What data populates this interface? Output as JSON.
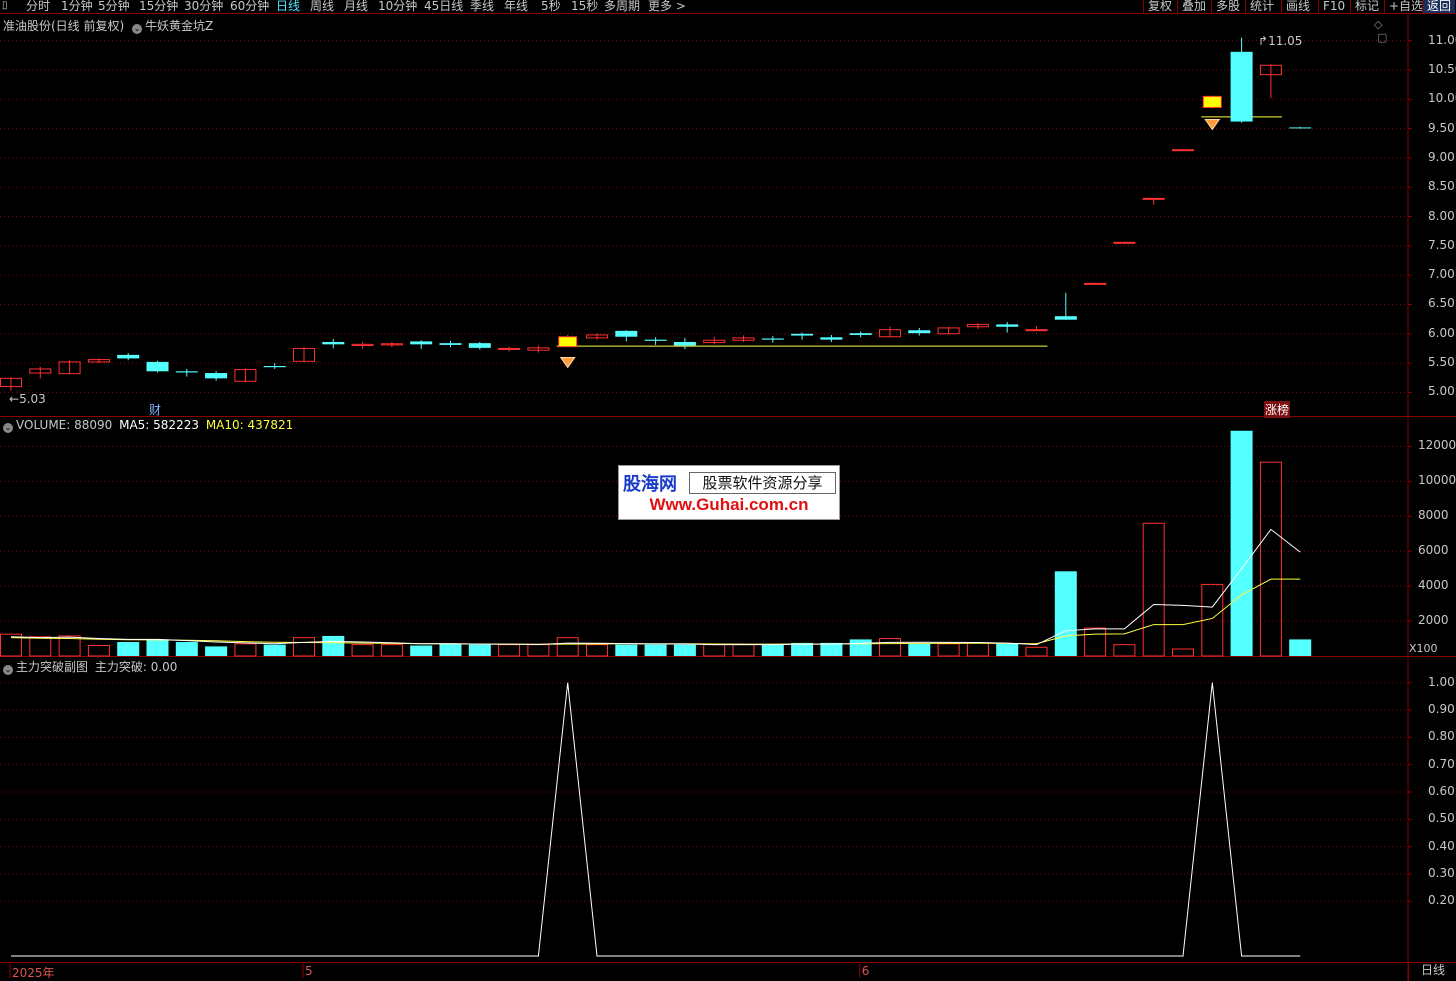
{
  "toolbar": {
    "periods": [
      "分时",
      "1分钟",
      "5分钟",
      "15分钟",
      "30分钟",
      "60分钟",
      "日线",
      "周线",
      "月线",
      "10分钟",
      "45日线",
      "季线",
      "年线",
      "5秒",
      "15秒",
      "多周期",
      "更多 >"
    ],
    "active_period": "日线",
    "right_items": [
      "复权",
      "叠加",
      "多股",
      "统计",
      "画线",
      "F10",
      "标记",
      "+自选",
      "返回"
    ]
  },
  "main_panel": {
    "title": "准油股份(日线 前复权)",
    "indicator_name": "牛妖黄金坑Z",
    "high_marker": "11.05",
    "low_marker": "5.03",
    "cai_badge": "财",
    "zhangbang_badge": "涨榜",
    "y_ticks": [
      "11.00",
      "10.50",
      "10.00",
      "9.50",
      "9.00",
      "8.50",
      "8.00",
      "7.50",
      "7.00",
      "6.50",
      "6.00",
      "5.50",
      "5.00"
    ]
  },
  "volume_panel": {
    "label_volume": "VOLUME: 88090",
    "label_ma5": "MA5: 582223",
    "label_ma10": "MA10: 437821",
    "y_ticks": [
      "12000",
      "10000",
      "8000",
      "6000",
      "4000",
      "2000"
    ],
    "unit": "X100"
  },
  "sub_panel": {
    "title": "主力突破副图",
    "value_label": "主力突破: 0.00",
    "y_ticks": [
      "1.00",
      "0.90",
      "0.80",
      "0.70",
      "0.60",
      "0.50",
      "0.40",
      "0.30",
      "0.20"
    ]
  },
  "x_axis": {
    "labels": [
      "2025年",
      "5",
      "6"
    ]
  },
  "bottom_tab": "日线",
  "watermark": {
    "brand": "股海网",
    "tagline": "股票软件资源分享",
    "url": "Www.Guhai.com.cn"
  },
  "colors": {
    "up": "#ff3030",
    "down": "#54ffff",
    "ma5": "#ffffff",
    "ma10": "#ffff40",
    "grid": "#8a0000",
    "signal": "#ffff00"
  },
  "chart_data": [
    {
      "type": "candlestick",
      "title": "准油股份(日线 前复权)",
      "ylim": [
        4.7,
        11.25
      ],
      "candles": [
        {
          "o": 5.1,
          "c": 5.24,
          "h": 5.26,
          "l": 5.03
        },
        {
          "o": 5.33,
          "c": 5.4,
          "h": 5.44,
          "l": 5.24
        },
        {
          "o": 5.32,
          "c": 5.52,
          "h": 5.55,
          "l": 5.31
        },
        {
          "o": 5.52,
          "c": 5.56,
          "h": 5.58,
          "l": 5.5
        },
        {
          "o": 5.64,
          "c": 5.58,
          "h": 5.67,
          "l": 5.55
        },
        {
          "o": 5.52,
          "c": 5.36,
          "h": 5.54,
          "l": 5.34
        },
        {
          "o": 5.36,
          "c": 5.34,
          "h": 5.4,
          "l": 5.27
        },
        {
          "o": 5.33,
          "c": 5.24,
          "h": 5.36,
          "l": 5.2
        },
        {
          "o": 5.19,
          "c": 5.39,
          "h": 5.41,
          "l": 5.17
        },
        {
          "o": 5.45,
          "c": 5.43,
          "h": 5.5,
          "l": 5.4
        },
        {
          "o": 5.53,
          "c": 5.75,
          "h": 5.77,
          "l": 5.52
        },
        {
          "o": 5.86,
          "c": 5.82,
          "h": 5.91,
          "l": 5.75
        },
        {
          "o": 5.8,
          "c": 5.82,
          "h": 5.86,
          "l": 5.75
        },
        {
          "o": 5.81,
          "c": 5.83,
          "h": 5.86,
          "l": 5.77
        },
        {
          "o": 5.87,
          "c": 5.82,
          "h": 5.89,
          "l": 5.74
        },
        {
          "o": 5.84,
          "c": 5.81,
          "h": 5.88,
          "l": 5.77
        },
        {
          "o": 5.84,
          "c": 5.76,
          "h": 5.86,
          "l": 5.73
        },
        {
          "o": 5.74,
          "c": 5.75,
          "h": 5.78,
          "l": 5.7
        },
        {
          "o": 5.72,
          "c": 5.76,
          "h": 5.8,
          "l": 5.68
        },
        {
          "o": 5.8,
          "c": 5.95,
          "h": 5.98,
          "l": 5.79
        },
        {
          "o": 5.93,
          "c": 5.98,
          "h": 6.01,
          "l": 5.9
        },
        {
          "o": 6.05,
          "c": 5.95,
          "h": 6.06,
          "l": 5.87
        },
        {
          "o": 5.9,
          "c": 5.88,
          "h": 5.94,
          "l": 5.81
        },
        {
          "o": 5.86,
          "c": 5.8,
          "h": 5.93,
          "l": 5.74
        },
        {
          "o": 5.85,
          "c": 5.89,
          "h": 5.95,
          "l": 5.82
        },
        {
          "o": 5.89,
          "c": 5.93,
          "h": 5.97,
          "l": 5.86
        },
        {
          "o": 5.92,
          "c": 5.9,
          "h": 5.96,
          "l": 5.85
        },
        {
          "o": 6.0,
          "c": 5.97,
          "h": 6.02,
          "l": 5.9
        },
        {
          "o": 5.94,
          "c": 5.9,
          "h": 5.98,
          "l": 5.86
        },
        {
          "o": 6.01,
          "c": 5.98,
          "h": 6.04,
          "l": 5.94
        },
        {
          "o": 5.95,
          "c": 6.07,
          "h": 6.12,
          "l": 5.94
        },
        {
          "o": 6.06,
          "c": 6.01,
          "h": 6.1,
          "l": 5.97
        },
        {
          "o": 6.0,
          "c": 6.1,
          "h": 6.12,
          "l": 5.99
        },
        {
          "o": 6.12,
          "c": 6.16,
          "h": 6.18,
          "l": 6.08
        },
        {
          "o": 6.16,
          "c": 6.12,
          "h": 6.2,
          "l": 6.02
        },
        {
          "o": 6.07,
          "c": 6.07,
          "h": 6.13,
          "l": 6.05
        },
        {
          "o": 6.3,
          "c": 6.24,
          "h": 6.7,
          "l": 6.24
        },
        {
          "o": 6.86,
          "c": 6.86,
          "h": 6.87,
          "l": 6.86
        },
        {
          "o": 7.56,
          "c": 7.56,
          "h": 7.57,
          "l": 7.56
        },
        {
          "o": 8.31,
          "c": 8.31,
          "h": 8.31,
          "l": 8.2
        },
        {
          "o": 9.14,
          "c": 9.14,
          "h": 9.15,
          "l": 9.14
        },
        {
          "o": 9.86,
          "c": 10.05,
          "h": 10.05,
          "l": 9.84
        },
        {
          "o": 10.81,
          "c": 9.62,
          "h": 11.05,
          "l": 9.6
        },
        {
          "o": 10.42,
          "c": 10.58,
          "h": 10.6,
          "l": 10.02
        },
        {
          "o": 9.52,
          "c": 9.51,
          "h": 9.53,
          "l": 9.5
        }
      ],
      "signal_candles": [
        19,
        41
      ],
      "support_lines": [
        {
          "from": 19,
          "to": 35,
          "value": 5.79
        },
        {
          "from": 41,
          "to": 43,
          "value": 9.7
        }
      ]
    },
    {
      "type": "bar",
      "title": "VOLUME",
      "ylim": [
        0,
        13000
      ],
      "values": [
        1250,
        1100,
        1150,
        600,
        800,
        950,
        800,
        550,
        700,
        650,
        1050,
        1150,
        650,
        650,
        600,
        700,
        650,
        650,
        650,
        1050,
        650,
        650,
        650,
        650,
        650,
        650,
        650,
        750,
        750,
        950,
        1000,
        700,
        700,
        750,
        700,
        500,
        4850,
        1600,
        650,
        7600,
        400,
        4100,
        12900,
        11100,
        950
      ],
      "ma5": [
        1100,
        1050,
        1080,
        1000,
        950,
        950,
        880,
        800,
        750,
        700,
        780,
        840,
        800,
        760,
        700,
        700,
        680,
        670,
        660,
        740,
        730,
        710,
        690,
        690,
        650,
        650,
        650,
        670,
        680,
        720,
        780,
        790,
        780,
        770,
        740,
        650,
        1450,
        1550,
        1550,
        2950,
        2900,
        2800,
        5000,
        7250,
        5950
      ],
      "ma10": [
        1050,
        1020,
        1000,
        960,
        930,
        920,
        900,
        870,
        820,
        790,
        770,
        760,
        740,
        720,
        700,
        700,
        690,
        680,
        670,
        680,
        690,
        700,
        700,
        700,
        690,
        680,
        680,
        690,
        690,
        700,
        710,
        720,
        720,
        730,
        720,
        700,
        1150,
        1250,
        1270,
        1800,
        1800,
        2150,
        3500,
        4400,
        4400
      ]
    },
    {
      "type": "line",
      "title": "主力突破副图",
      "ylim": [
        0,
        1.05
      ],
      "values": [
        0,
        0,
        0,
        0,
        0,
        0,
        0,
        0,
        0,
        0,
        0,
        0,
        0,
        0,
        0,
        0,
        0,
        0,
        0,
        1,
        0,
        0,
        0,
        0,
        0,
        0,
        0,
        0,
        0,
        0,
        0,
        0,
        0,
        0,
        0,
        0,
        0,
        0,
        0,
        0,
        0,
        1,
        0,
        0,
        0
      ]
    }
  ]
}
